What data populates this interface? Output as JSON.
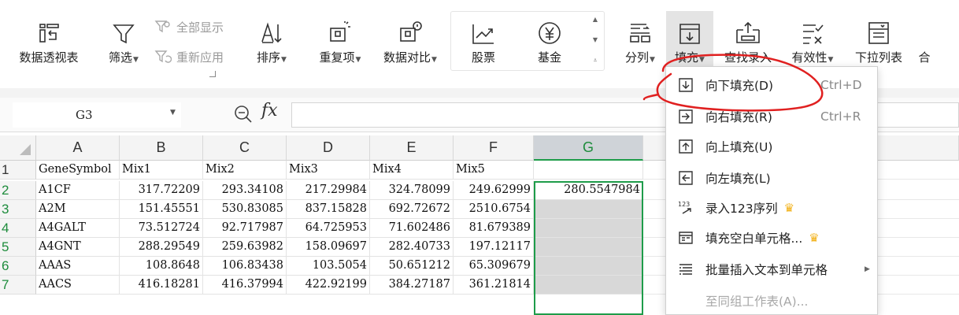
{
  "ribbon": {
    "pivot_label": "数据透视表",
    "filter_label": "筛选",
    "show_all_label": "全部显示",
    "reapply_label": "重新应用",
    "sort_label": "排序",
    "duplicates_label": "重复项",
    "compare_label": "数据对比",
    "stock_label": "股票",
    "fund_label": "基金",
    "split_label": "分列",
    "fill_label": "填充",
    "lookup_label": "查找录入",
    "validity_label": "有效性",
    "dropdown_list_label": "下拉列表",
    "merge_label": "合"
  },
  "formula_bar": {
    "name_box": "G3",
    "fx": "fx",
    "formula": ""
  },
  "sheet": {
    "columns": [
      "A",
      "B",
      "C",
      "D",
      "E",
      "F",
      "G"
    ],
    "selected_column": "G",
    "rows": [
      {
        "num": "1",
        "cells": [
          "GeneSymbol",
          "Mix1",
          "Mix2",
          "Mix3",
          "Mix4",
          "Mix5",
          ""
        ]
      },
      {
        "num": "2",
        "cells": [
          "A1CF",
          "317.72209",
          "293.34108",
          "217.29984",
          "324.78099",
          "249.62999",
          "280.5547984"
        ]
      },
      {
        "num": "3",
        "cells": [
          "A2M",
          "151.45551",
          "530.83085",
          "837.15828",
          "692.72672",
          "2510.6754",
          ""
        ]
      },
      {
        "num": "4",
        "cells": [
          "A4GALT",
          "73.512724",
          "92.717987",
          "64.725953",
          "71.602486",
          "81.679389",
          ""
        ]
      },
      {
        "num": "5",
        "cells": [
          "A4GNT",
          "288.29549",
          "259.63982",
          "158.09697",
          "282.40733",
          "197.12117",
          ""
        ]
      },
      {
        "num": "6",
        "cells": [
          "AAAS",
          "108.8648",
          "106.83438",
          "103.5054",
          "50.651212",
          "65.309679",
          ""
        ]
      },
      {
        "num": "7",
        "cells": [
          "AACS",
          "416.18281",
          "416.37994",
          "422.92199",
          "384.27187",
          "361.21814",
          ""
        ]
      }
    ]
  },
  "fill_menu": {
    "items": [
      {
        "label": "向下填充(D)",
        "shortcut": "Ctrl+D",
        "icon": "fill-down-icon"
      },
      {
        "label": "向右填充(R)",
        "shortcut": "Ctrl+R",
        "icon": "fill-right-icon"
      },
      {
        "label": "向上填充(U)",
        "shortcut": "",
        "icon": "fill-up-icon"
      },
      {
        "label": "向左填充(L)",
        "shortcut": "",
        "icon": "fill-left-icon"
      },
      {
        "label": "录入123序列",
        "shortcut": "",
        "icon": "sequence-123-icon",
        "premium": true
      },
      {
        "label": "填充空白单元格...",
        "shortcut": "",
        "icon": "fill-blank-icon",
        "premium": true
      },
      {
        "label": "批量插入文本到单元格",
        "shortcut": "",
        "icon": "insert-text-icon",
        "submenu": true
      },
      {
        "label": "至同组工作表(A)...",
        "shortcut": "",
        "icon": "",
        "disabled": true
      }
    ]
  },
  "colors": {
    "selection_green": "#1e9c4a",
    "annotation_red": "#e02020",
    "premium_gold": "#f2b21c"
  }
}
